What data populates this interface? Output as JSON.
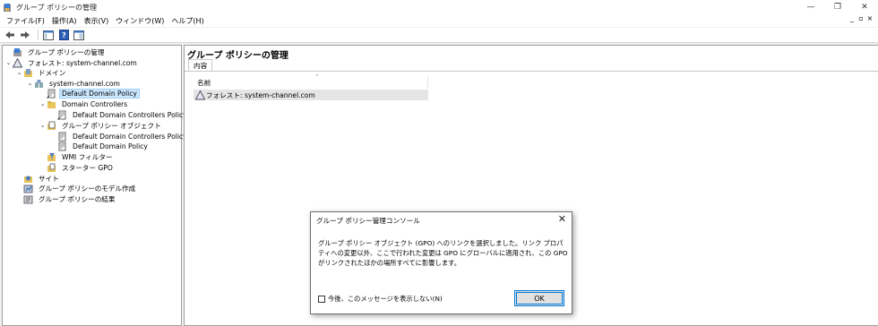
{
  "window": {
    "title": "グループ ポリシーの管理",
    "controls": [
      "—",
      "❐",
      "✕"
    ]
  },
  "menubar": {
    "items": [
      "ファイル(F)",
      "操作(A)",
      "表示(V)",
      "ウィンドウ(W)",
      "ヘルプ(H)"
    ],
    "mdi_controls": [
      "_",
      "▫",
      "×"
    ]
  },
  "toolbar": {
    "icons": [
      "back-arrow-icon",
      "forward-arrow-icon",
      "show-hide-tree-icon",
      "help-icon",
      "console-view-icon"
    ]
  },
  "tree": [
    {
      "label": "グループ ポリシーの管理",
      "icon": "gpm-root-icon",
      "chev": ""
    },
    {
      "label": "フォレスト: system-channel.com",
      "icon": "forest-icon",
      "chev": "⌄"
    },
    {
      "label": "ドメイン",
      "icon": "domains-folder-icon",
      "chev": "⌄"
    },
    {
      "label": "system-channel.com",
      "icon": "domain-icon",
      "chev": "⌄"
    },
    {
      "label": "Default Domain Policy",
      "icon": "gpo-link-icon",
      "chev": "",
      "selected": true
    },
    {
      "label": "Domain Controllers",
      "icon": "ou-folder-icon",
      "chev": "⌄"
    },
    {
      "label": "Default Domain Controllers Policy",
      "icon": "gpo-link-icon",
      "chev": ""
    },
    {
      "label": "グループ ポリシー オブジェクト",
      "icon": "gpo-folder-icon",
      "chev": "⌄"
    },
    {
      "label": "Default Domain Controllers Policy",
      "icon": "gpo-icon",
      "chev": ""
    },
    {
      "label": "Default Domain Policy",
      "icon": "gpo-icon",
      "chev": ""
    },
    {
      "label": "WMI フィルター",
      "icon": "wmi-filter-icon",
      "chev": ""
    },
    {
      "label": "スターター GPO",
      "icon": "starter-gpo-icon",
      "chev": ""
    },
    {
      "label": "サイト",
      "icon": "sites-icon",
      "chev": ""
    },
    {
      "label": "グループ ポリシーのモデル作成",
      "icon": "modeling-icon",
      "chev": ""
    },
    {
      "label": "グループ ポリシーの結果",
      "icon": "results-icon",
      "chev": ""
    }
  ],
  "right_pane": {
    "header": "グループ ポリシーの管理",
    "tab": "内容",
    "column": "名前",
    "sort_indicator": "⌃",
    "row": "フォレスト: system-channel.com"
  },
  "dialog": {
    "title": "グループ ポリシー管理コンソール",
    "close": "✕",
    "message": "グループ ポリシー オブジェクト (GPO) へのリンクを選択しました。リンク プロパティへの変更以外、ここで行われた変更は GPO にグローバルに適用され、この GPO がリンクされたほかの場所すべてに影響します。",
    "checkbox_label": "今後、このメッセージを表示しない(N)",
    "ok_label": "OK"
  }
}
